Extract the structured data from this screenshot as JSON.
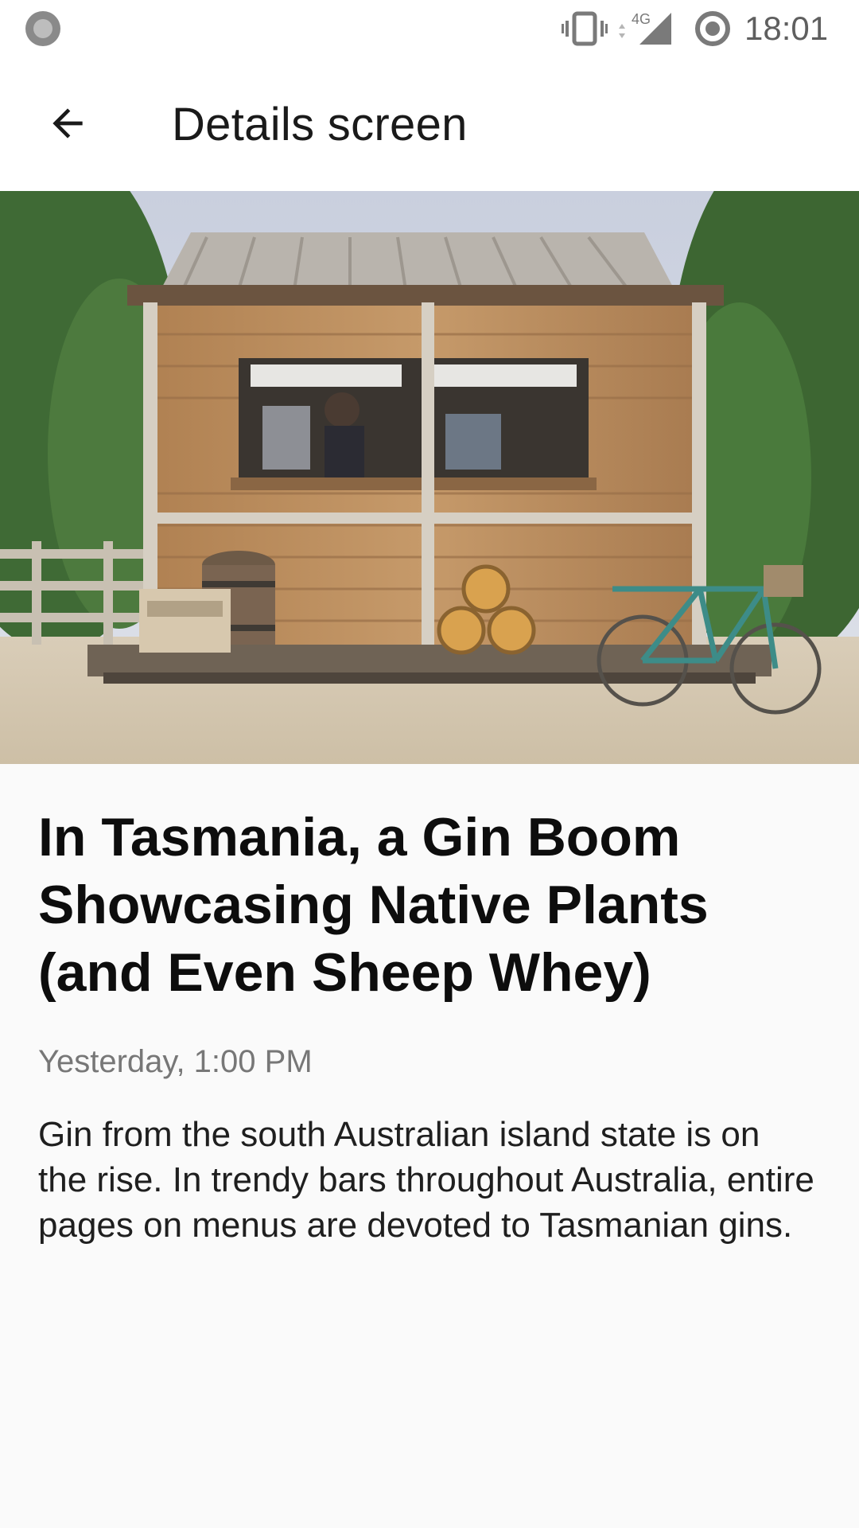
{
  "status_bar": {
    "time": "18:01",
    "network_label": "4G",
    "icons": [
      "notification-dot-icon",
      "vibrate-icon",
      "signal-4g-icon",
      "sync-icon"
    ]
  },
  "app_bar": {
    "title": "Details screen",
    "back_icon": "arrow-back-icon"
  },
  "hero_image": {
    "subject": "wooden-cabin-bar-with-bicycle-and-barrels"
  },
  "article": {
    "headline": "In Tasmania, a Gin Boom Showcasing Native Plants (and Even Sheep Whey)",
    "timestamp": "Yesterday, 1:00 PM",
    "summary": "Gin from the south Australian island state is on the rise. In trendy bars throughout Australia, entire pages on menus are devoted to Tasmanian gins."
  },
  "colors": {
    "background": "#fafafa",
    "app_bar": "#ffffff",
    "headline": "#0d0d0d",
    "timestamp": "#777777"
  }
}
